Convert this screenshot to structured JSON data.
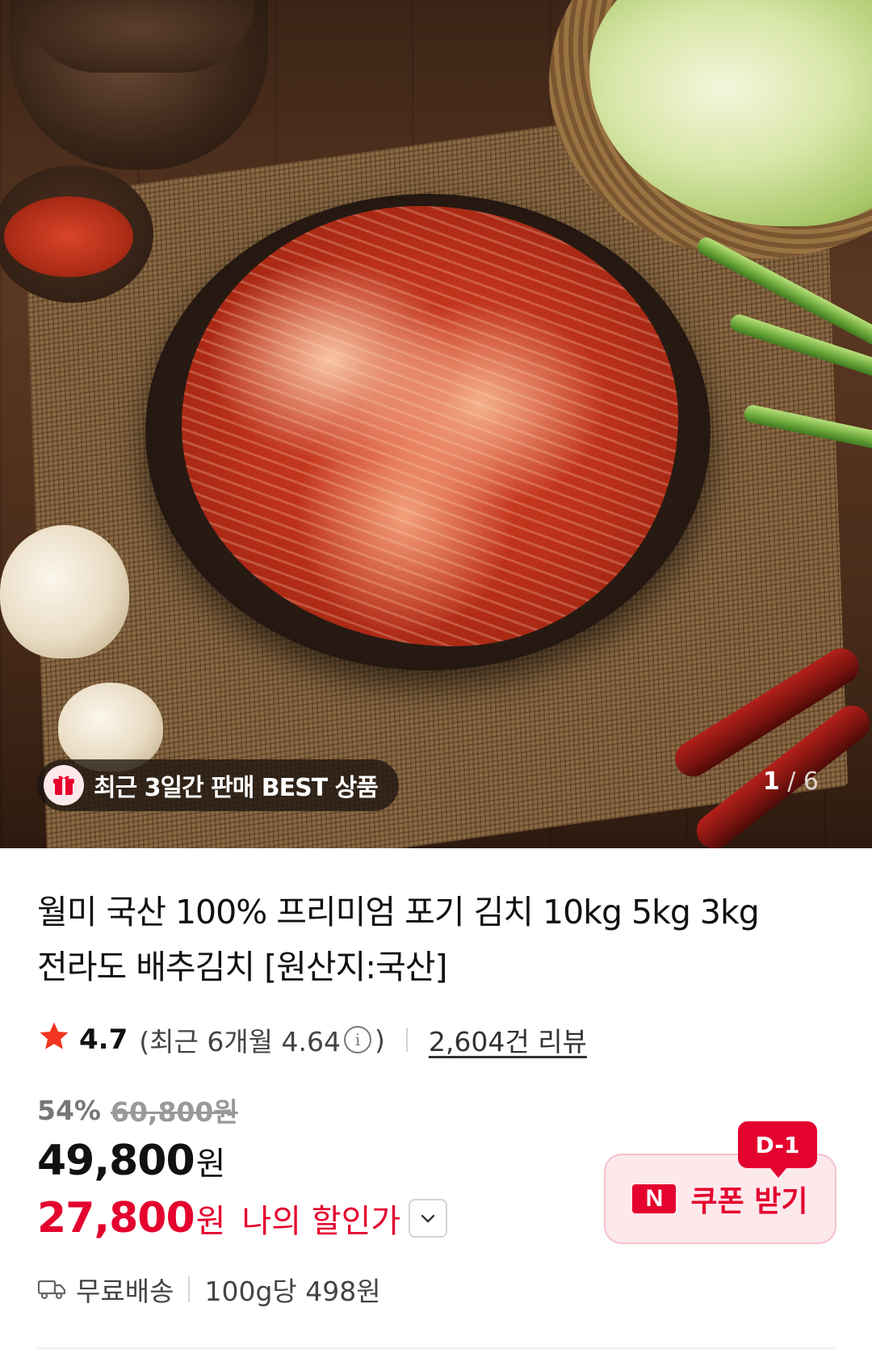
{
  "hero": {
    "badge_text": "최근 3일간 판매 BEST 상품",
    "counter_current": "1",
    "counter_separator": "/",
    "counter_total": "6"
  },
  "product": {
    "title_line1": "월미 국산 100% 프리미엄 포기 김치 10kg 5kg 3kg",
    "title_line2": "전라도 배추김치 [원산지:국산]"
  },
  "rating": {
    "score": "4.7",
    "recent_prefix": "(최근 6개월 4.64",
    "info_glyph": "i",
    "recent_suffix": ")",
    "review_count": "2,604건 리뷰"
  },
  "price": {
    "discount_pct": "54%",
    "original": "60,800원",
    "sale_value": "49,800",
    "sale_unit": "원",
    "my_value": "27,800",
    "my_unit": "원",
    "my_label": "나의 할인가"
  },
  "coupon": {
    "badge": "D-1",
    "logo": "N",
    "label": "쿠폰 받기"
  },
  "shipping": {
    "free_label": "무료배송",
    "unit_price": "100g당 498원"
  },
  "colors": {
    "accent": "#e4032e",
    "coupon_bg": "#fde8ec",
    "star": "#f2361f"
  }
}
